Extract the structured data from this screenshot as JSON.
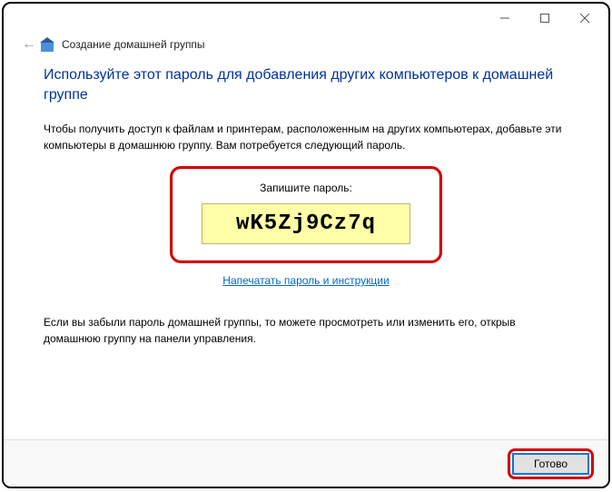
{
  "window": {
    "wizard_title": "Создание домашней группы"
  },
  "instruction": "Используйте этот пароль для добавления других компьютеров к домашней группе",
  "intro_text": "Чтобы получить доступ к файлам и принтерам, расположенным на других компьютерах, добавьте эти компьютеры в домашнюю группу. Вам потребуется следующий пароль.",
  "password": {
    "label": "Запишите пароль:",
    "value": "wK5Zj9Cz7q"
  },
  "print_link": "Напечатать пароль и инструкции",
  "note_text": "Если вы забыли пароль домашней группы, то можете просмотреть или изменить его, открыв домашнюю группу на панели управления.",
  "buttons": {
    "done": "Готово"
  }
}
